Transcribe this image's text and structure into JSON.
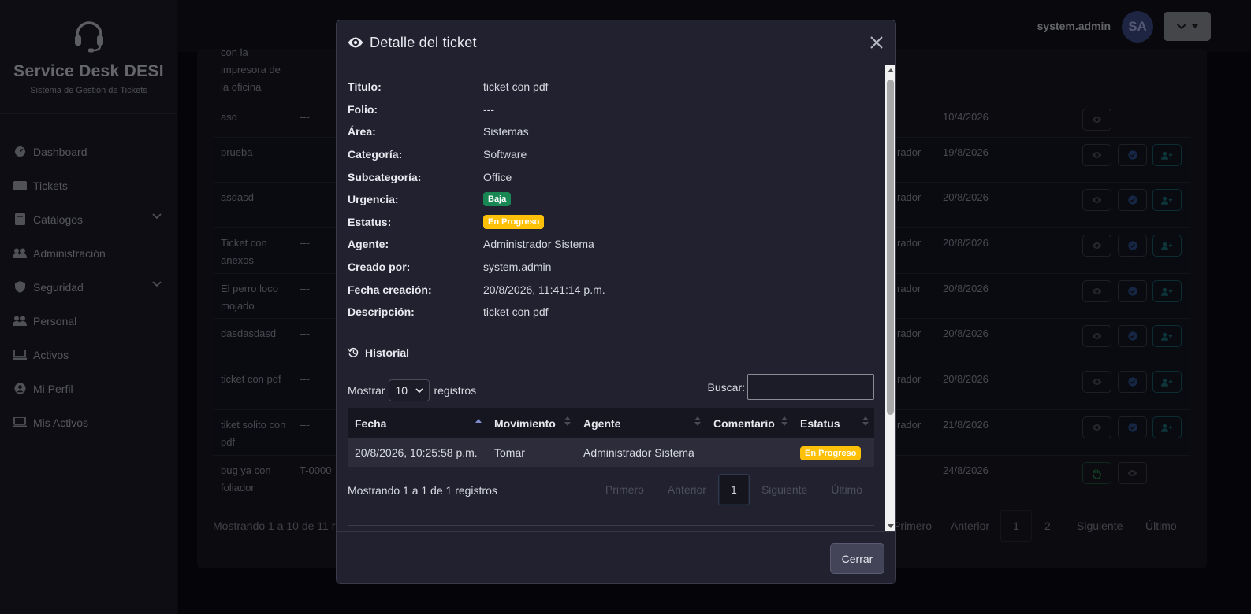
{
  "app": {
    "title": "Service Desk DESI",
    "subtitle": "Sistema de Gestión de Tickets"
  },
  "sidebar": {
    "items": [
      {
        "label": "Dashboard",
        "icon": "gauge-icon"
      },
      {
        "label": "Tickets",
        "icon": "ticket-icon"
      },
      {
        "label": "Catálogos",
        "icon": "book-icon",
        "expandable": true
      },
      {
        "label": "Administración",
        "icon": "users-icon"
      },
      {
        "label": "Seguridad",
        "icon": "shield-icon",
        "expandable": true
      },
      {
        "label": "Personal",
        "icon": "users-icon"
      },
      {
        "label": "Activos",
        "icon": "laptop-icon"
      },
      {
        "label": "Mi Perfil",
        "icon": "user-circle-icon"
      },
      {
        "label": "Mis Activos",
        "icon": "laptop-icon"
      }
    ]
  },
  "topbar": {
    "username": "system.admin",
    "avatar_initials": "SA"
  },
  "background_table": {
    "rows": [
      {
        "title": "con la impresora de la oficina",
        "folio": "",
        "col3": "",
        "date": ""
      },
      {
        "title": "asd",
        "folio": "---",
        "col3": "",
        "date": "10/4/2026"
      },
      {
        "title": "prueba",
        "folio": "---",
        "col3": "rador",
        "date": "19/8/2026"
      },
      {
        "title": "asdasd",
        "folio": "---",
        "col3": "rador",
        "date": "20/8/2026"
      },
      {
        "title": "Ticket con anexos",
        "folio": "---",
        "col3": "rador",
        "date": "20/8/2026"
      },
      {
        "title": "El perro loco mojado",
        "folio": "---",
        "col3": "rador",
        "date": "20/8/2026"
      },
      {
        "title": "dasdasdasd",
        "folio": "---",
        "col3": "rador",
        "date": "20/8/2026"
      },
      {
        "title": "ticket con pdf",
        "folio": "---",
        "col3": "rador",
        "date": "20/8/2026"
      },
      {
        "title": "tiket solito con pdf",
        "folio": "---",
        "col3": "rador",
        "date": "21/8/2026"
      },
      {
        "title": "bug ya con foliador",
        "folio": "T-0000",
        "col3": "",
        "date": "24/8/2026"
      }
    ],
    "info": "Mostrando 1 a 10 de 11 r",
    "pager": {
      "first": "Primero",
      "prev": "Anterior",
      "pages": [
        "1",
        "2"
      ],
      "next": "Siguiente",
      "last": "Último"
    }
  },
  "modal": {
    "title": "Detalle del ticket",
    "details": [
      {
        "label": "Título:",
        "value": "ticket con pdf"
      },
      {
        "label": "Folio:",
        "value": "---"
      },
      {
        "label": "Área:",
        "value": "Sistemas"
      },
      {
        "label": "Categoría:",
        "value": "Software"
      },
      {
        "label": "Subcategoría:",
        "value": "Office"
      },
      {
        "label": "Urgencia:",
        "value": "Baja",
        "badge": "green"
      },
      {
        "label": "Estatus:",
        "value": "En Progreso",
        "badge": "yellow"
      },
      {
        "label": "Agente:",
        "value": "Administrador Sistema"
      },
      {
        "label": "Creado por:",
        "value": "system.admin"
      },
      {
        "label": "Fecha creación:",
        "value": "20/8/2026, 11:41:14 p.m."
      },
      {
        "label": "Descripción:",
        "value": "ticket con pdf"
      }
    ],
    "history": {
      "title": "Historial",
      "length_label_before": "Mostrar",
      "length_value": "10",
      "length_label_after": "registros",
      "search_label": "Buscar:",
      "search_value": "",
      "columns": [
        "Fecha",
        "Movimiento",
        "Agente",
        "Comentario",
        "Estatus"
      ],
      "rows": [
        {
          "fecha": "20/8/2026, 10:25:58 p.m.",
          "movimiento": "Tomar",
          "agente": "Administrador Sistema",
          "comentario": "",
          "estatus": "En Progreso"
        }
      ],
      "info": "Mostrando 1 a 1 de 1 registros",
      "pager": {
        "first": "Primero",
        "prev": "Anterior",
        "current": "1",
        "next": "Siguiente",
        "last": "Último"
      }
    },
    "close_button": "Cerrar"
  },
  "colors": {
    "badge_green": "#198754",
    "badge_yellow": "#ffc107",
    "avatar": "#3b4a86"
  }
}
